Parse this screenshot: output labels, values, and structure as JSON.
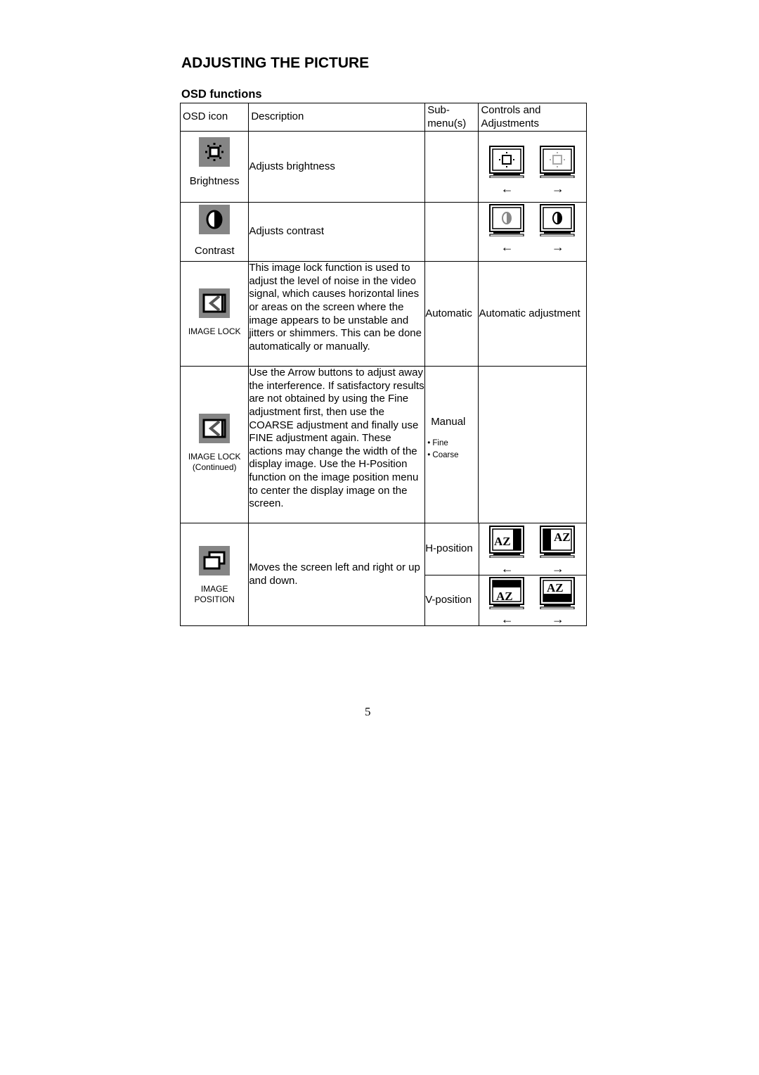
{
  "page": {
    "title": "ADJUSTING THE PICTURE",
    "section_title": "OSD functions",
    "page_number": "5"
  },
  "table": {
    "headers": {
      "osd_icon": "OSD icon",
      "description": "Description",
      "submenus": "Sub-\nmenu(s)",
      "submenus_line1": "Sub-",
      "submenus_line2": "menu(s)",
      "controls_line1": "Controls and",
      "controls_line2": "Adjustments"
    },
    "rows": [
      {
        "icon": "brightness-sun-icon",
        "icon_label": "Brightness",
        "description": "Adjusts brightness",
        "submenu": "",
        "controls": {
          "left_arrow": "←",
          "right_arrow": "→"
        }
      },
      {
        "icon": "contrast-circle-icon",
        "icon_label": "Contrast",
        "description": "Adjusts contrast",
        "submenu": "",
        "controls": {
          "left_arrow": "←",
          "right_arrow": "→"
        }
      },
      {
        "icon": "image-lock-icon",
        "icon_label": "IMAGE LOCK",
        "description": "This image lock function is used to adjust the level of noise in the video signal, which causes horizontal lines or areas on the screen where the image appears to be unstable and jitters or shimmers. This can be done automatically or manually.",
        "submenu": "Automatic",
        "controls_text": "Automatic adjustment"
      },
      {
        "icon": "image-lock-icon",
        "icon_label": "IMAGE LOCK",
        "icon_label_2": "(Continued)",
        "description": "Use the Arrow buttons to adjust away the interference. If satisfactory results are not obtained by using the Fine adjustment first, then use the COARSE adjustment and finally use FINE adjustment again. These actions may change the width of the display image. Use the H-Position function on the image position menu to center the display image on the screen.",
        "submenu_title": "Manual",
        "submenu_items": [
          "• Fine",
          "• Coarse"
        ]
      },
      {
        "icon": "image-position-icon",
        "icon_label": "IMAGE",
        "icon_label_2": "POSITION",
        "description": "Moves the screen left and right or up and down.",
        "submenus": [
          "H-position",
          "V-position"
        ],
        "monitor_text": "AZ",
        "controls": {
          "left_arrow": "←",
          "right_arrow": "→"
        }
      }
    ]
  }
}
